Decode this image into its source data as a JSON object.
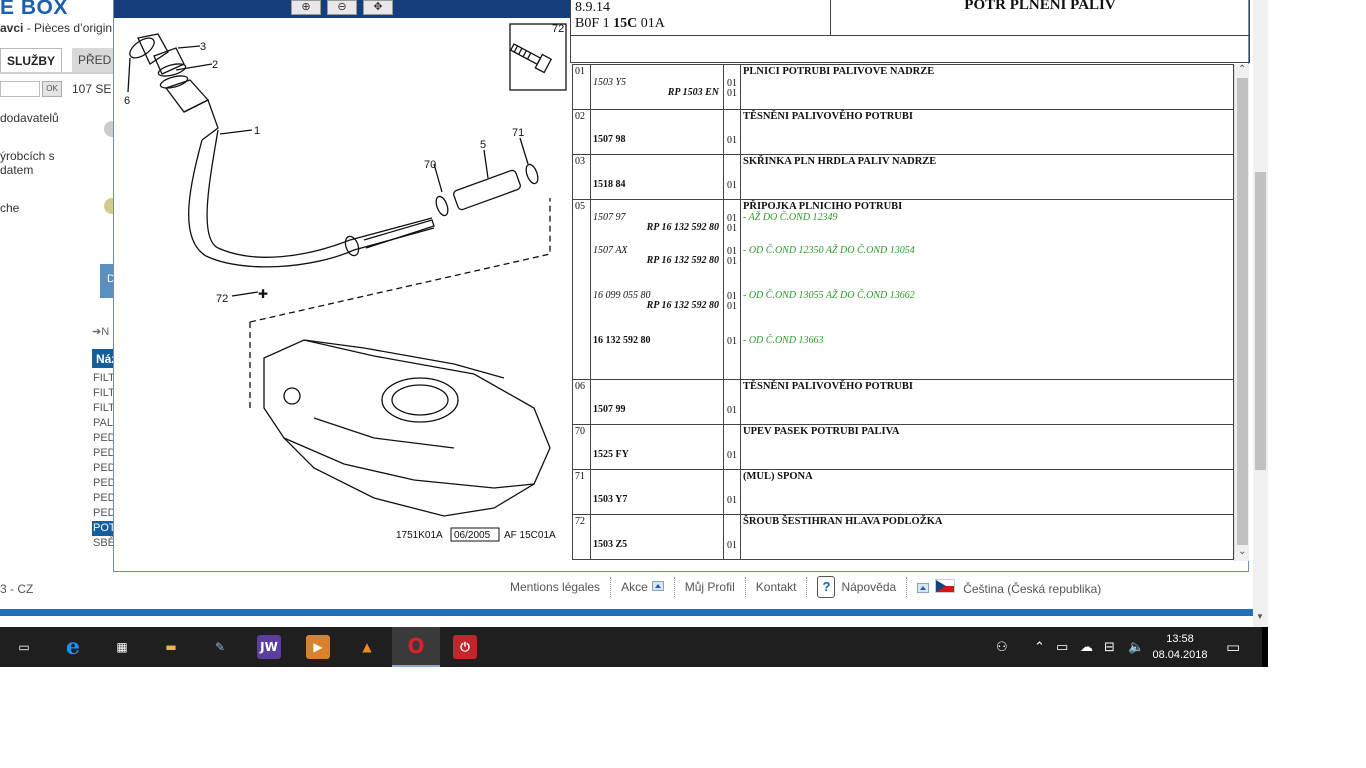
{
  "background_page": {
    "logo": "E BOX",
    "subtitle_bold": "avci",
    "subtitle_rest": " - Pièces d’origin",
    "tabs": [
      {
        "label": "SLUŽBY"
      },
      {
        "label": "PŘED"
      }
    ],
    "search_ok": "OK",
    "result_count": "107 SE",
    "links": [
      {
        "label": "dodavatelů"
      },
      {
        "label": "ýrobcích s"
      },
      {
        "label": " datem"
      },
      {
        "label": "che"
      }
    ],
    "blue_box_label": "D",
    "arrow_label": "➔N",
    "list_header": "Náz",
    "list_items": [
      {
        "label": "FILT"
      },
      {
        "label": "FILT"
      },
      {
        "label": "FILT"
      },
      {
        "label": "PAL"
      },
      {
        "label": "PED"
      },
      {
        "label": "PED"
      },
      {
        "label": "PED"
      },
      {
        "label": "PED"
      },
      {
        "label": "PED"
      },
      {
        "label": "PED"
      },
      {
        "label": "POT"
      },
      {
        "label": "SBĚ"
      }
    ],
    "selected_index": 10,
    "copyright": "3 - CZ"
  },
  "footer": {
    "links": [
      {
        "label": "Mentions légales"
      },
      {
        "label": "Akce"
      },
      {
        "label": "Můj Profil"
      },
      {
        "label": "Kontakt"
      },
      {
        "label": "Nápověda"
      },
      {
        "label": "Čeština (Česká republika)"
      }
    ],
    "help_glyph": "?"
  },
  "popup": {
    "toolbar": {
      "zoom_in_icon": "zoom-in-icon",
      "zoom_out_icon": "zoom-out-icon",
      "pan_icon": "zoom-pan-icon"
    },
    "header": {
      "date": "8.9.14",
      "code_prefix": "B0F 1 ",
      "code_bold": "15C",
      "code_suffix": " 01A",
      "title": "POTR PLNENI PALIV"
    },
    "diagram": {
      "callouts": [
        "1",
        "2",
        "3",
        "5",
        "6",
        "70",
        "71",
        "72",
        "72"
      ],
      "ref_a": "1751K01A",
      "ref_date": "06/2005",
      "ref_b": "AF 15C01A"
    },
    "parts": [
      {
        "pos": "01",
        "desc": "PLNICI POTRUBI PALIVOVE NADRZE",
        "lines": [
          {
            "pn": "1503 Y5",
            "style": "it",
            "qty": "01"
          },
          {
            "pn": "RP 1503 EN",
            "style": "it-bold",
            "qty": "01"
          }
        ],
        "notes": []
      },
      {
        "pos": "02",
        "desc": "TĚSNĚNI PALIVOVĚHO POTRUBI",
        "lines": [
          {
            "pn": "1507 98",
            "style": "bold",
            "qty": "01"
          }
        ],
        "notes": []
      },
      {
        "pos": "03",
        "desc": "SKŘINKA PLN HRDLA PALIV NADRZE",
        "lines": [
          {
            "pn": "1518 84",
            "style": "bold",
            "qty": "01"
          }
        ],
        "notes": []
      },
      {
        "pos": "05",
        "desc": "PŘIPOJKA PLNICIHO POTRUBI",
        "lines": [
          {
            "pn": "1507 97",
            "style": "it",
            "qty": "01"
          },
          {
            "pn": "RP 16 132 592 80",
            "style": "it-bold",
            "qty": "01"
          },
          {
            "pn": "1507 AX",
            "style": "it",
            "qty": "01"
          },
          {
            "pn": "RP 16 132 592 80",
            "style": "it-bold",
            "qty": "01"
          },
          {
            "pn": "16 099 055 80",
            "style": "it",
            "qty": "01"
          },
          {
            "pn": "RP 16 132 592 80",
            "style": "it-bold",
            "qty": "01"
          },
          {
            "pn": "16 132 592 80",
            "style": "bold",
            "qty": "01"
          }
        ],
        "notes": [
          "- AŽ DO Č.OND 12349",
          "- OD Č.OND 12350 AŽ DO Č.OND 13054",
          "- OD Č.OND 13055 AŽ DO Č.OND 13662",
          "- OD Č.OND 13663"
        ]
      },
      {
        "pos": "06",
        "desc": "TĚSNĚNI PALIVOVĚHO POTRUBI",
        "lines": [
          {
            "pn": "1507 99",
            "style": "bold",
            "qty": "01"
          }
        ],
        "notes": []
      },
      {
        "pos": "70",
        "desc": "UPEV PASEK POTRUBI PALIVA",
        "lines": [
          {
            "pn": "1525 FY",
            "style": "bold",
            "qty": "01"
          }
        ],
        "notes": []
      },
      {
        "pos": "71",
        "desc": "(MUL) SPONA",
        "lines": [
          {
            "pn": "1503 Y7",
            "style": "bold",
            "qty": "01"
          }
        ],
        "notes": []
      },
      {
        "pos": "72",
        "desc": "ŠROUB ŠESTIHRAN HLAVA PODLOŽKA",
        "lines": [
          {
            "pn": "1503 Z5",
            "style": "bold",
            "qty": "01"
          }
        ],
        "notes": []
      }
    ]
  },
  "taskbar": {
    "apps": [
      {
        "name": "task-view-icon",
        "glyph": "▭"
      },
      {
        "name": "edge-icon",
        "glyph": "e"
      },
      {
        "name": "store-icon",
        "glyph": "▦"
      },
      {
        "name": "file-explorer-icon",
        "glyph": "▬"
      },
      {
        "name": "paint-icon",
        "glyph": "✎"
      },
      {
        "name": "jw-icon",
        "glyph": "JW"
      },
      {
        "name": "media-player-icon",
        "glyph": "▶"
      },
      {
        "name": "vlc-icon",
        "glyph": "▲"
      },
      {
        "name": "opera-icon",
        "glyph": "O"
      },
      {
        "name": "power-app-icon",
        "glyph": "⏻"
      }
    ],
    "time": "13:58",
    "date": "08.04.2018"
  },
  "colors": {
    "brand_blue": "#1b5fae",
    "toolbar_navy": "#153e7a",
    "note_green": "#2a9a2a",
    "taskbar": "#1f1f1f"
  }
}
